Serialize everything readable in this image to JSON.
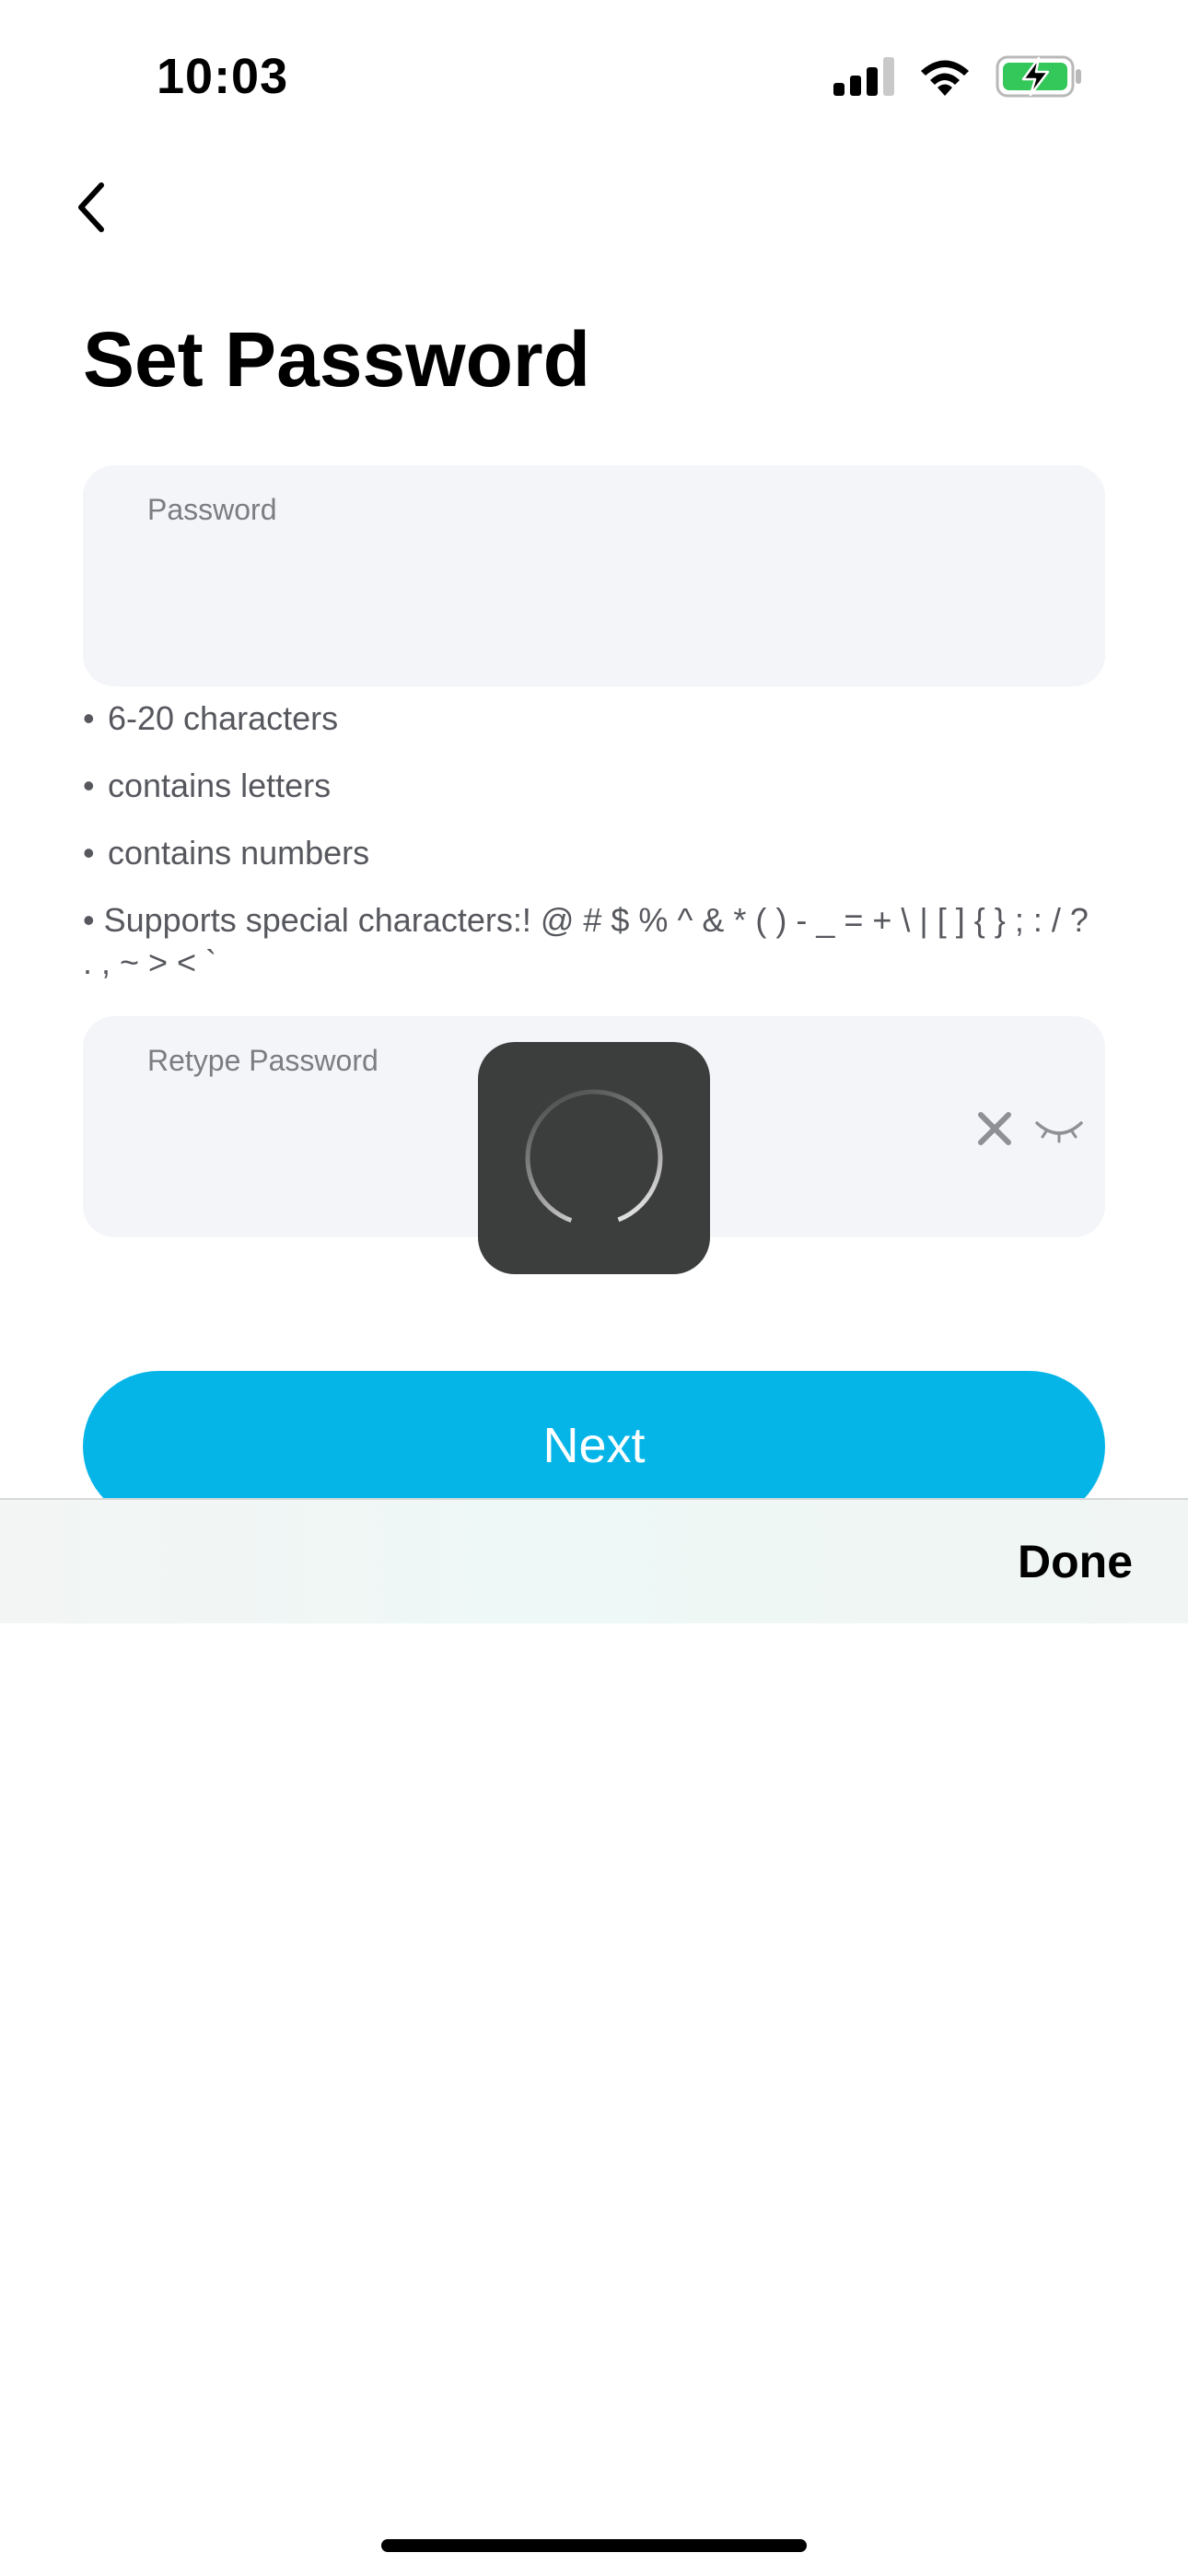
{
  "status_bar": {
    "time": "10:03",
    "icons": [
      "cellular-signal-icon",
      "wifi-icon",
      "battery-charging-icon"
    ],
    "battery_color": "#34c759"
  },
  "nav": {
    "back_icon": "chevron-left-icon"
  },
  "title": "Set Password",
  "password_field": {
    "label": "Password",
    "value": ""
  },
  "rules": [
    "6-20 characters",
    "contains letters",
    "contains numbers",
    "Supports special characters:! @ # $ % ^ & * ( ) - _ = + \\ | [ ] { } ; : / ? . , ~ > < `"
  ],
  "retype_field": {
    "label": "Retype Password",
    "value": "",
    "clear_icon": "close-icon",
    "visibility_icon": "eye-closed-icon"
  },
  "next_button": {
    "label": "Next",
    "color": "#06b5e8"
  },
  "keyboard_accessory": {
    "done_label": "Done"
  },
  "loading": {
    "icon": "spinner-icon"
  }
}
